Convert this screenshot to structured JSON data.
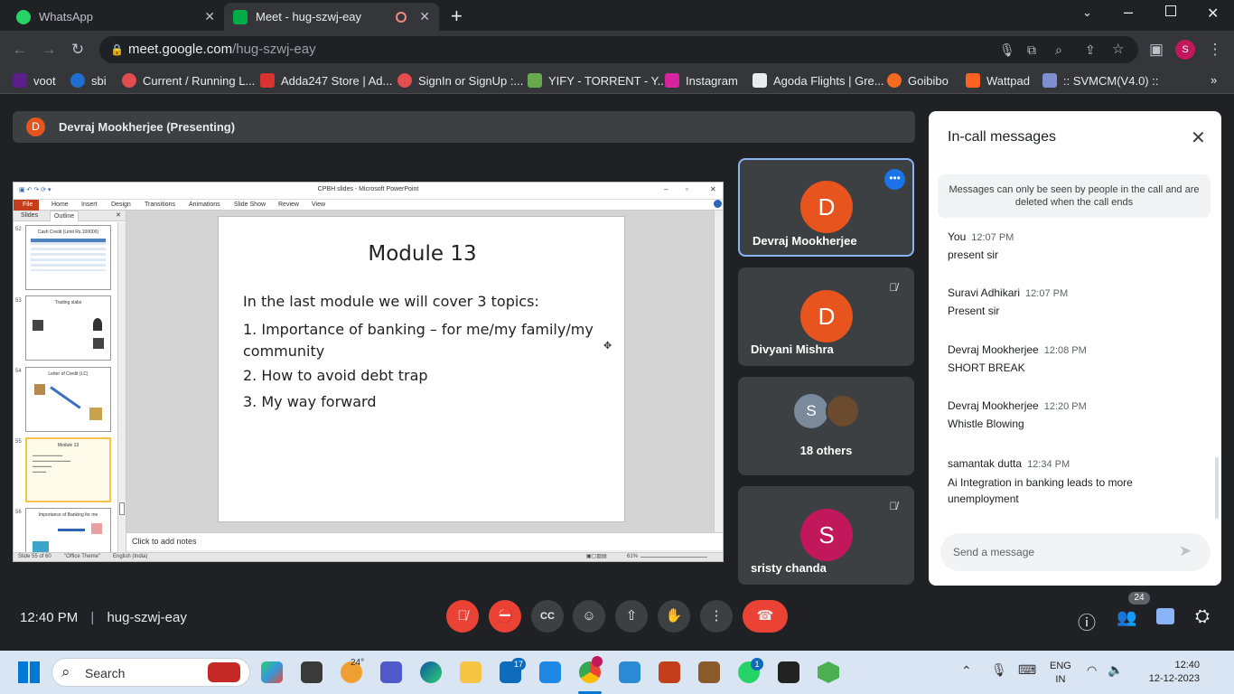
{
  "browser": {
    "tabs": [
      {
        "title": "WhatsApp",
        "active": false
      },
      {
        "title": "Meet - hug-szwj-eay",
        "active": true
      }
    ],
    "url_host": "meet.google.com",
    "url_path": "/hug-szwj-eay",
    "profile_initial": "S",
    "bookmarks": [
      {
        "label": "voot",
        "color": "#5a1f8a"
      },
      {
        "label": "sbi",
        "color": "#1f6fd1"
      },
      {
        "label": "Current / Running L...",
        "color": "#e34d4d"
      },
      {
        "label": "Adda247 Store | Ad...",
        "color": "#d9322f"
      },
      {
        "label": "SignIn or SignUp :...",
        "color": "#e34d4d"
      },
      {
        "label": "YIFY - TORRENT - Y...",
        "color": "#6aa84f"
      },
      {
        "label": "Instagram",
        "color": "#d6249f"
      },
      {
        "label": "Agoda Flights | Gre...",
        "color": "#e8eaed"
      },
      {
        "label": "Goibibo",
        "color": "#f26b21"
      },
      {
        "label": "Wattpad",
        "color": "#ff6122"
      },
      {
        "label": ":: SVMCM(V4.0) ::",
        "color": "#7b8fd1"
      }
    ]
  },
  "meet": {
    "presenter_bar": {
      "initial": "D",
      "label": "Devraj Mookherjee (Presenting)"
    },
    "meeting_time": "12:40 PM",
    "meeting_code": "hug-szwj-eay",
    "participant_count": "24",
    "tiles": [
      {
        "initial": "D",
        "name": "Devraj Mookherjee",
        "color": "#e8541d",
        "muted": false
      },
      {
        "initial": "D",
        "name": "Divyani Mishra",
        "color": "#e8541d",
        "muted": true
      },
      {
        "initial": "S",
        "name": "18 others",
        "color": "#7a8a9a",
        "muted": false
      },
      {
        "initial": "S",
        "name": "sristy chanda",
        "color": "#c2185b",
        "muted": true
      }
    ],
    "chat": {
      "title": "In-call messages",
      "notice": "Messages can only be seen by people in the call and are deleted when the call ends",
      "messages": [
        {
          "sender": "You",
          "time": "12:07 PM",
          "text": "present sir"
        },
        {
          "sender": "Suravi Adhikari",
          "time": "12:07 PM",
          "text": "Present sir"
        },
        {
          "sender": "Devraj Mookherjee",
          "time": "12:08 PM",
          "text": "SHORT  BREAK"
        },
        {
          "sender": "Devraj Mookherjee",
          "time": "12:20 PM",
          "text": "Whistle Blowing"
        },
        {
          "sender": "samantak dutta",
          "time": "12:34 PM",
          "text": "Ai Integration in banking leads to more unemployment"
        }
      ],
      "input_placeholder": "Send a message"
    }
  },
  "ppt": {
    "window_title": "CPBH slides - Microsoft PowerPoint",
    "ribbon_tabs": [
      "File",
      "Home",
      "Insert",
      "Design",
      "Transitions",
      "Animations",
      "Slide Show",
      "Review",
      "View"
    ],
    "pane_tabs": [
      "Slides",
      "Outline"
    ],
    "thumbnails": [
      {
        "num": "52",
        "title": "Cash Credit (Limit Rs.100000)"
      },
      {
        "num": "53",
        "title": "Trading slabs"
      },
      {
        "num": "54",
        "title": "Letter of Credit (LC)"
      },
      {
        "num": "55",
        "title": "Module 13"
      },
      {
        "num": "56",
        "title": "Importance of Banking for me"
      }
    ],
    "slide": {
      "title": "Module 13",
      "intro": "In the last module we will cover 3 topics:",
      "points": [
        "1. Importance of banking – for me/my family/my community",
        "2. How to avoid debt trap",
        "3. My way forward"
      ]
    },
    "notes_placeholder": "Click to add notes",
    "status": {
      "slide": "Slide 55 of 60",
      "theme": "\"Office Theme\"",
      "language": "English (India)",
      "zoom": "61%"
    }
  },
  "taskbar": {
    "search_label": "Search",
    "weather": "24°",
    "lang_line1": "ENG",
    "lang_line2": "IN",
    "clock_time": "12:40",
    "clock_date": "12-12-2023",
    "badges": {
      "mail": "17",
      "whatsapp": "1"
    }
  }
}
